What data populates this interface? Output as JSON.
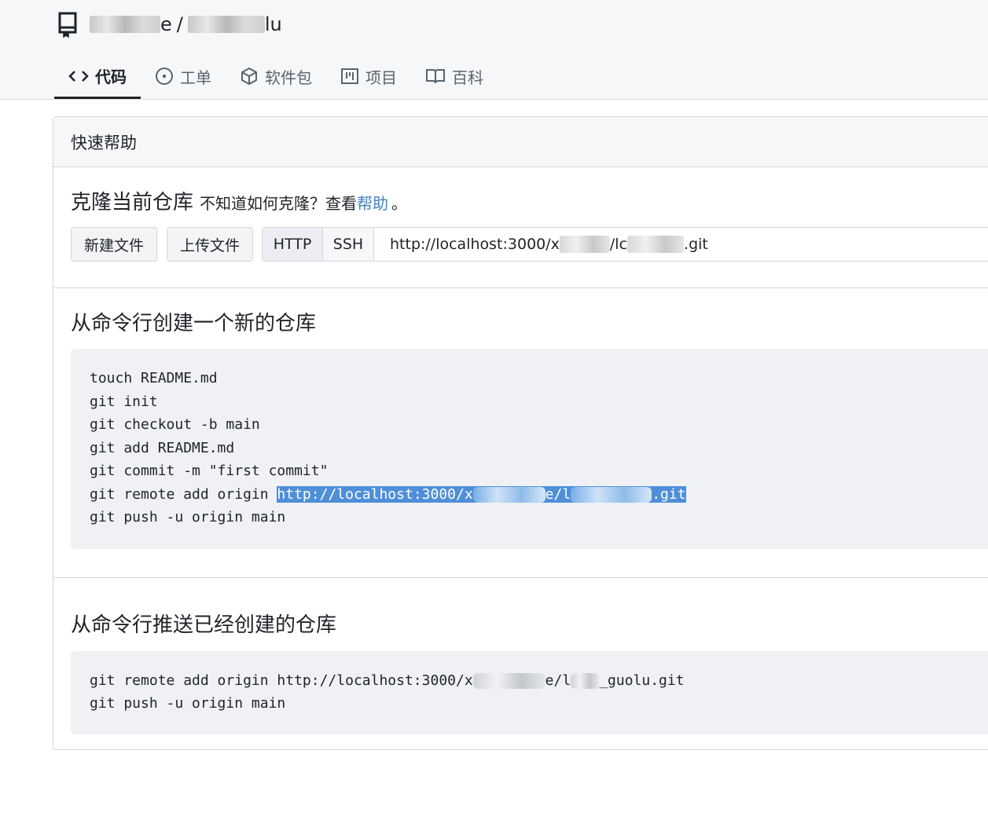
{
  "repo": {
    "owner_visible": "e",
    "separator": "/",
    "name_visible": "lu"
  },
  "tabs": [
    {
      "label": "代码",
      "icon": "code-icon",
      "active": true
    },
    {
      "label": "工单",
      "icon": "issue-icon",
      "active": false
    },
    {
      "label": "软件包",
      "icon": "package-icon",
      "active": false
    },
    {
      "label": "项目",
      "icon": "project-icon",
      "active": false
    },
    {
      "label": "百科",
      "icon": "book-icon",
      "active": false
    }
  ],
  "quick_help": {
    "title": "快速帮助",
    "clone_title": "克隆当前仓库",
    "clone_hint": "不知道如何克隆？查看",
    "help_link": "帮助",
    "period": "。",
    "new_file_button": "新建文件",
    "upload_file_button": "上传文件",
    "http_button": "HTTP",
    "ssh_button": "SSH",
    "clone_url_prefix": "http://localhost:3000/x",
    "clone_url_mid": "/lc",
    "clone_url_suffix": ".git"
  },
  "new_repo": {
    "title": "从命令行创建一个新的仓库",
    "lines": [
      "touch README.md",
      "git init",
      "git checkout -b main",
      "git add README.md",
      "git commit -m \"first commit\"",
      "git push -u origin main"
    ],
    "remote_cmd": "git remote add origin ",
    "remote_url_prefix": "http://localhost:3000/x",
    "remote_url_mid": "e/l",
    "remote_url_suffix": ".git"
  },
  "push_repo": {
    "title": "从命令行推送已经创建的仓库",
    "remote_cmd": "git remote add origin http://localhost:3000/x",
    "remote_url_mid": "e/l",
    "remote_url_suffix": "_guolu.git",
    "push_line": "git push -u origin main"
  },
  "colors": {
    "accent_link": "#4183c4",
    "selection": "#4f8fd9",
    "code_bg": "#eff1f4"
  }
}
